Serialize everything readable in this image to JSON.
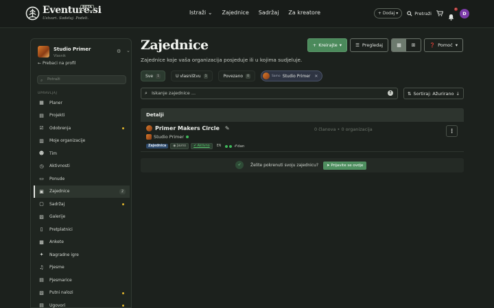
{
  "brand": {
    "name": "Eventure.si",
    "badge": "BETA",
    "tagline": "Ustvari. Sodeluj. Podeli."
  },
  "nav": {
    "links": [
      "Istraži",
      "Zajednice",
      "Sadržaj",
      "Za kreatore"
    ],
    "add_label": "+ Dodaj",
    "search_label": "Pretraži",
    "notif_count": "0",
    "avatar_letter": "D"
  },
  "sidebar": {
    "profile_name": "Studio Primer",
    "profile_role": "Vlasnik",
    "back_label": "Prebaci na profil",
    "search_placeholder": "Potraži",
    "section_label": "UPRAVLJAJ",
    "items": [
      {
        "label": "Planer",
        "icon": "calendar-icon",
        "dot": false
      },
      {
        "label": "Projekti",
        "icon": "folder-icon",
        "dot": false
      },
      {
        "label": "Odobrenja",
        "icon": "check-icon",
        "dot": true
      },
      {
        "label": "Moje organizacije",
        "icon": "building-icon",
        "dot": false
      },
      {
        "label": "Tim",
        "icon": "team-icon",
        "dot": false
      },
      {
        "label": "Aktivnosti",
        "icon": "activity-icon",
        "dot": false
      },
      {
        "label": "Ponude",
        "icon": "offer-icon",
        "dot": false
      },
      {
        "label": "Zajednice",
        "icon": "community-icon",
        "dot": false,
        "active": true,
        "count": "2"
      },
      {
        "label": "Sadržaj",
        "icon": "content-icon",
        "dot": true
      },
      {
        "label": "Galerije",
        "icon": "gallery-icon",
        "dot": false
      },
      {
        "label": "Pretplatnici",
        "icon": "subscribers-icon",
        "dot": false
      },
      {
        "label": "Ankete",
        "icon": "poll-icon",
        "dot": false
      },
      {
        "label": "Nagradne igre",
        "icon": "prize-icon",
        "dot": false
      },
      {
        "label": "Pjesme",
        "icon": "music-icon",
        "dot": false
      },
      {
        "label": "Pjesmarice",
        "icon": "songbook-icon",
        "dot": false
      },
      {
        "label": "Putni nalozi",
        "icon": "travel-icon",
        "dot": true
      },
      {
        "label": "Ugovori",
        "icon": "contract-icon",
        "dot": true
      }
    ]
  },
  "page": {
    "title": "Zajednice",
    "subtitle": "Zajednice koje vaša organizacija posjeduje ili u kojima sudjeluje.",
    "create_label": "Kreirajte",
    "overview_label": "Pregledaj",
    "help_label": "Pomoć"
  },
  "filters": {
    "tabs": [
      {
        "label": "Sve",
        "count": "1",
        "selected": true
      },
      {
        "label": "U vlasništvu",
        "count": "1",
        "selected": false
      },
      {
        "label": "Povezano",
        "count": "0",
        "selected": false
      }
    ],
    "chip_prefix": "Samo",
    "chip_label": "Studio Primer"
  },
  "search": {
    "placeholder": "Iskanje zajednice ...",
    "sort_label": "Sortiraj: Ažurirano"
  },
  "table": {
    "header": "Detalji",
    "rows": [
      {
        "title": "Primer Makers Circle",
        "owner": "Studio Primer",
        "tags": [
          "Zajednica",
          "Javno",
          "Aktivno",
          "EN"
        ],
        "author": "dan",
        "stats": "0 članova  •  0 organizacija"
      }
    ]
  },
  "cta": {
    "text": "Želite pokrenuti svoju zajednicu?",
    "button": "Prijavite se ovdje"
  },
  "colors": {
    "accent_green": "#4b8a5b",
    "background": "#1c211d",
    "warning_dot": "#e2b62c",
    "status_green": "#3fb95b"
  }
}
